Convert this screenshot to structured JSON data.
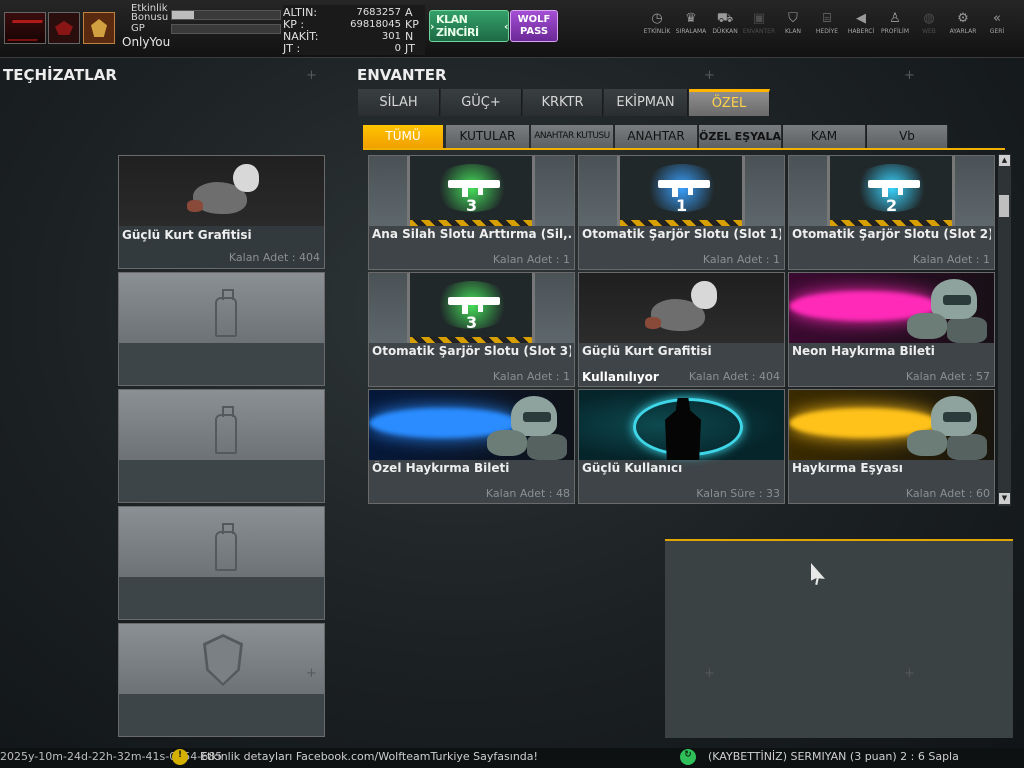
{
  "topbar": {
    "player": {
      "etkinlik_label": "Etkinlik",
      "bonus_label": "Bonusu",
      "gp_label": "GP",
      "username": "OnlyYou",
      "bonus_progress_pct": 20,
      "gp_progress_pct": 0
    },
    "currencies": [
      {
        "label": "ALTIN:",
        "value": "7683257",
        "unit": "A"
      },
      {
        "label": "KP  :",
        "value": "69818045",
        "unit": "KP"
      },
      {
        "label": "NAKİT:",
        "value": "301",
        "unit": "N"
      },
      {
        "label": "JT  :",
        "value": "0",
        "unit": "JT"
      }
    ],
    "klan_button": "KLAN ZİNCİRİ",
    "wolf_pass_line1": "WOLF",
    "wolf_pass_line2": "PASS",
    "nav": [
      {
        "label": "ETKİNLİK",
        "icon": "stopwatch-icon",
        "glyph": "◷",
        "enabled": true
      },
      {
        "label": "SIRALAMA",
        "icon": "medal-icon",
        "glyph": "♛",
        "enabled": true
      },
      {
        "label": "DÜKKAN",
        "icon": "cart-icon",
        "glyph": "⛟",
        "enabled": true
      },
      {
        "label": "ENVANTER",
        "icon": "inventory-icon",
        "glyph": "▣",
        "enabled": false
      },
      {
        "label": "KLAN",
        "icon": "clan-shield-icon",
        "glyph": "⛉",
        "enabled": true
      },
      {
        "label": "HEDİYE",
        "icon": "gift-icon",
        "glyph": "⌸",
        "enabled": true
      },
      {
        "label": "HABERCİ",
        "icon": "megaphone-icon",
        "glyph": "◀",
        "enabled": true
      },
      {
        "label": "PROFİLİM",
        "icon": "profile-icon",
        "glyph": "♙",
        "enabled": true
      },
      {
        "label": "WEB",
        "icon": "globe-icon",
        "glyph": "◍",
        "enabled": false
      },
      {
        "label": "AYARLAR",
        "icon": "gear-icon",
        "glyph": "⚙",
        "enabled": true
      },
      {
        "label": "GERİ",
        "icon": "back-icon",
        "glyph": "«",
        "enabled": true
      }
    ]
  },
  "equipment": {
    "title": "TEÇHİZATLAR",
    "slots": [
      {
        "type": "filled",
        "name": "Güçlü Kurt Grafitisi",
        "count": "Kalan Adet : 404"
      },
      {
        "type": "spray"
      },
      {
        "type": "spray"
      },
      {
        "type": "spray"
      },
      {
        "type": "shield"
      }
    ]
  },
  "inventory": {
    "title": "ENVANTER",
    "main_tabs": [
      "SİLAH",
      "GÜÇ+",
      "KRKTR",
      "EKİPMAN",
      "ÖZEL"
    ],
    "active_main_tab": 4,
    "sub_tabs": [
      "TÜMÜ",
      "KUTULAR",
      "ANAHTAR KUTUSU",
      "ANAHTAR",
      "ÖZEL EŞYALAR",
      "KAM",
      "Vb"
    ],
    "active_sub_tab": 0,
    "items": [
      {
        "kind": "slot",
        "glow": "#46e05a",
        "number": "3",
        "name": "Ana Silah Slotu Arttırma (Sil,...",
        "count": "Kalan Adet : 1"
      },
      {
        "kind": "slot",
        "glow": "#3aa0ff",
        "number": "1",
        "name": "Otomatik Şarjör Slotu (Slot 1)",
        "count": "Kalan Adet : 1"
      },
      {
        "kind": "slot",
        "glow": "#3ad4ff",
        "number": "2",
        "name": "Otomatik Şarjör Slotu (Slot 2)",
        "count": "Kalan Adet : 1"
      },
      {
        "kind": "slot",
        "glow": "#46e05a",
        "number": "3",
        "name": "Otomatik Şarjör Slotu (Slot 3)",
        "count": "Kalan Adet : 1"
      },
      {
        "kind": "wolf",
        "name": "Güçlü Kurt Grafitisi",
        "count": "Kalan Adet : 404",
        "status": "Kullanılıyor"
      },
      {
        "kind": "shout",
        "beam": "#ff2ab8",
        "bg": "#3a0a30",
        "name": "Neon Haykırma Bileti",
        "count": "Kalan Adet : 57"
      },
      {
        "kind": "shout",
        "beam": "#2a8cff",
        "bg": "#06183a",
        "name": "Özel Haykırma Bileti",
        "count": "Kalan Adet : 48"
      },
      {
        "kind": "power",
        "name": "Güçlü Kullanıcı",
        "count": "Kalan Süre : 33"
      },
      {
        "kind": "shout",
        "beam": "#ffc21a",
        "bg": "#3a2a00",
        "name": "Haykırma Eşyası",
        "count": "Kalan Adet : 60"
      }
    ]
  },
  "bottombar": {
    "timestamp": "2025y-10m-24d-22h-32m-41s-0754-685",
    "notice": "Etkinlik detayları Facebook.com/WolfteamTurkiye Sayfasında!",
    "match": "(KAYBETTİNİZ) SERMIYAN (3 puan) 2 : 6 Sapla",
    "notice_icon": "warning-icon",
    "match_icon": "lost-match-icon",
    "colors": {
      "accent": "#f0b000",
      "green": "#2fc05a"
    }
  }
}
